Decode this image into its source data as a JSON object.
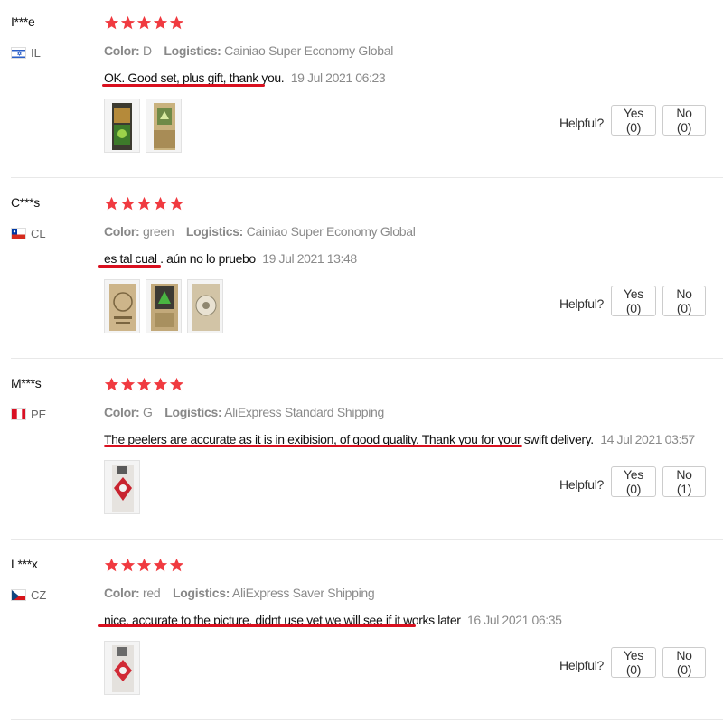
{
  "helpful_label": "Helpful?",
  "reviews": [
    {
      "user": "I***e",
      "country": "IL",
      "rating": 5,
      "color_label": "Color:",
      "color_value": "D",
      "logistics_label": "Logistics:",
      "logistics_value": "Cainiao Super Economy Global",
      "text": "OK. Good set, plus gift, thank you.",
      "date": "19 Jul 2021 06:23",
      "yes": "Yes (0)",
      "no": "No (0)"
    },
    {
      "user": "C***s",
      "country": "CL",
      "rating": 5,
      "color_label": "Color:",
      "color_value": "green",
      "logistics_label": "Logistics:",
      "logistics_value": "Cainiao Super Economy Global",
      "text": "es tal cual . aún no lo pruebo",
      "date": "19 Jul 2021 13:48",
      "yes": "Yes (0)",
      "no": "No (0)"
    },
    {
      "user": "M***s",
      "country": "PE",
      "rating": 5,
      "color_label": "Color:",
      "color_value": "G",
      "logistics_label": "Logistics:",
      "logistics_value": "AliExpress Standard Shipping",
      "text": "The peelers are accurate as it is in exibision, of good quality. Thank you for your swift delivery.",
      "date": "14 Jul 2021 03:57",
      "yes": "Yes (0)",
      "no": "No (1)"
    },
    {
      "user": "L***x",
      "country": "CZ",
      "rating": 5,
      "color_label": "Color:",
      "color_value": "red",
      "logistics_label": "Logistics:",
      "logistics_value": "AliExpress Saver Shipping",
      "text": "nice, accurate to the picture, didnt use yet we will see if it works later",
      "date": "16 Jul 2021 06:35",
      "yes": "Yes (0)",
      "no": "No (0)"
    }
  ],
  "colors": {
    "star": "#f03a40",
    "underline": "#d9101f",
    "meta": "#8a8a8a"
  }
}
